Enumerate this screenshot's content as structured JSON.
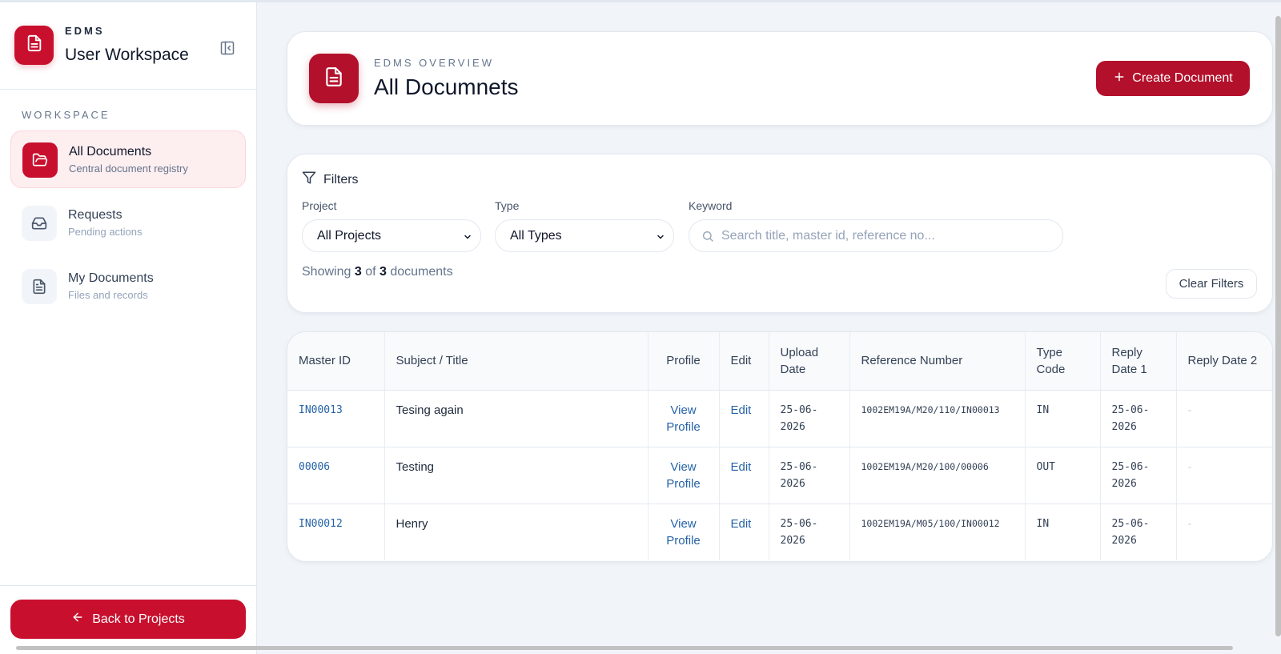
{
  "sidebar": {
    "brand_small": "EDMS",
    "brand_title": "User Workspace",
    "section_label": "WORKSPACE",
    "items": [
      {
        "title": "All Documents",
        "subtitle": "Central document registry"
      },
      {
        "title": "Requests",
        "subtitle": "Pending actions"
      },
      {
        "title": "My Documents",
        "subtitle": "Files and records"
      }
    ],
    "back_label": "Back to Projects"
  },
  "header": {
    "eyebrow": "EDMS OVERVIEW",
    "title": "All Documnets",
    "create_label": "Create Document"
  },
  "filters": {
    "heading": "Filters",
    "project_label": "Project",
    "project_value": "All Projects",
    "type_label": "Type",
    "type_value": "All Types",
    "keyword_label": "Keyword",
    "keyword_placeholder": "Search title, master id, reference no...",
    "showing_prefix": "Showing",
    "showing_count": "3",
    "showing_of": "of",
    "showing_total": "3",
    "showing_suffix": "documents",
    "clear_label": "Clear Filters"
  },
  "table": {
    "columns": [
      "Master ID",
      "Subject / Title",
      "Profile",
      "Edit",
      "Upload Date",
      "Reference Number",
      "Type Code",
      "Reply Date 1",
      "Reply Date 2"
    ],
    "rows": [
      {
        "master_id": "IN00013",
        "subject": "Tesing again",
        "profile": "View Profile",
        "edit": "Edit",
        "upload_date": "25-06-2026",
        "reference": "1002EM19A/M20/110/IN00013",
        "type_code": "IN",
        "reply1": "25-06-2026",
        "reply2": "-"
      },
      {
        "master_id": "00006",
        "subject": "Testing",
        "profile": "View Profile",
        "edit": "Edit",
        "upload_date": "25-06-2026",
        "reference": "1002EM19A/M20/100/00006",
        "type_code": "OUT",
        "reply1": "25-06-2026",
        "reply2": "-"
      },
      {
        "master_id": "IN00012",
        "subject": "Henry",
        "profile": "View Profile",
        "edit": "Edit",
        "upload_date": "25-06-2026",
        "reference": "1002EM19A/M05/100/IN00012",
        "type_code": "IN",
        "reply1": "25-06-2026",
        "reply2": "-"
      }
    ]
  },
  "colors": {
    "accent": "#c8102e",
    "link": "#2563a8"
  },
  "icons": [
    "document-icon",
    "collapse-sidebar-icon",
    "folder-open-icon",
    "inbox-icon",
    "file-text-icon",
    "arrow-left-icon",
    "plus-icon",
    "filter-icon",
    "chevron-down-icon",
    "search-icon"
  ]
}
